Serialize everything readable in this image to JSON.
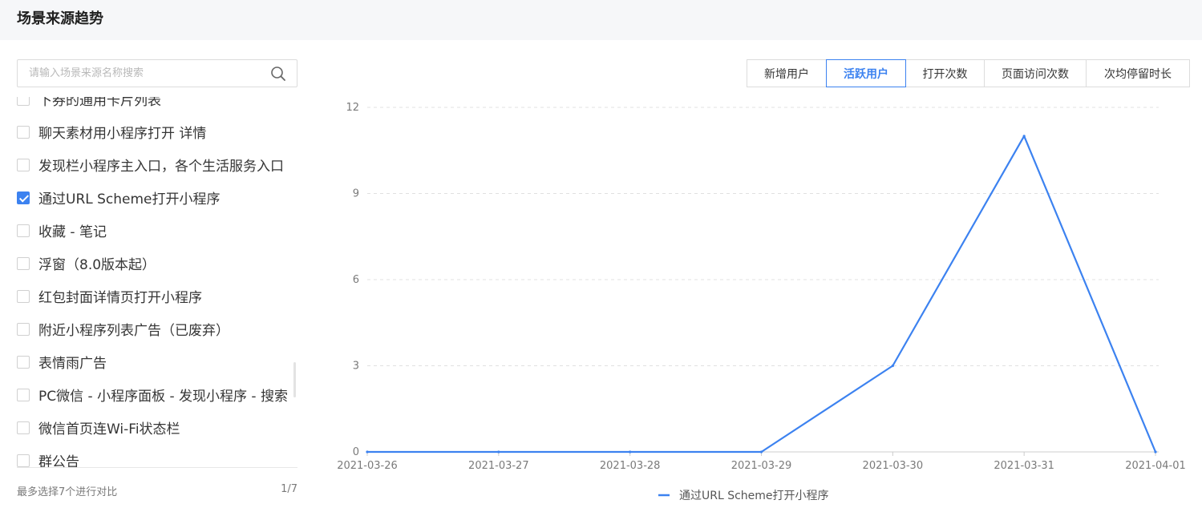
{
  "header": {
    "title": "场景来源趋势"
  },
  "search": {
    "placeholder": "请输入场景来源名称搜索",
    "value": ""
  },
  "scene_list": [
    {
      "label": "下券的通用卡片列表",
      "checked": false
    },
    {
      "label": "聊天素材用小程序打开 详情",
      "checked": false
    },
    {
      "label": "发现栏小程序主入口，各个生活服务入口",
      "checked": false
    },
    {
      "label": "通过URL Scheme打开小程序",
      "checked": true
    },
    {
      "label": "收藏 - 笔记",
      "checked": false
    },
    {
      "label": "浮窗（8.0版本起）",
      "checked": false
    },
    {
      "label": "红包封面详情页打开小程序",
      "checked": false
    },
    {
      "label": "附近小程序列表广告（已废弃）",
      "checked": false
    },
    {
      "label": "表情雨广告",
      "checked": false
    },
    {
      "label": "PC微信 - 小程序面板 - 发现小程序 - 搜索",
      "checked": false
    },
    {
      "label": "微信首页连Wi-Fi状态栏",
      "checked": false
    },
    {
      "label": "群公告",
      "checked": false
    }
  ],
  "footer": {
    "note": "最多选择7个进行对比",
    "page": "1/7"
  },
  "metric_tabs": [
    {
      "label": "新增用户",
      "active": false
    },
    {
      "label": "活跃用户",
      "active": true
    },
    {
      "label": "打开次数",
      "active": false
    },
    {
      "label": "页面访问次数",
      "active": false
    },
    {
      "label": "次均停留时长",
      "active": false
    }
  ],
  "colors": {
    "accent": "#3c82f0",
    "grid": "#e0e0e0",
    "axis": "#cccccc"
  },
  "chart_data": {
    "type": "line",
    "x": [
      "2021-03-26",
      "2021-03-27",
      "2021-03-28",
      "2021-03-29",
      "2021-03-30",
      "2021-03-31",
      "2021-04-01"
    ],
    "series": [
      {
        "name": "通过URL Scheme打开小程序",
        "values": [
          0,
          0,
          0,
          0,
          3,
          11,
          0
        ],
        "color": "#3c82f0"
      }
    ],
    "yticks": [
      0,
      3,
      6,
      9,
      12
    ],
    "ylim": [
      0,
      12
    ],
    "grid": "horizontal-dashed",
    "legend_position": "bottom-center"
  }
}
